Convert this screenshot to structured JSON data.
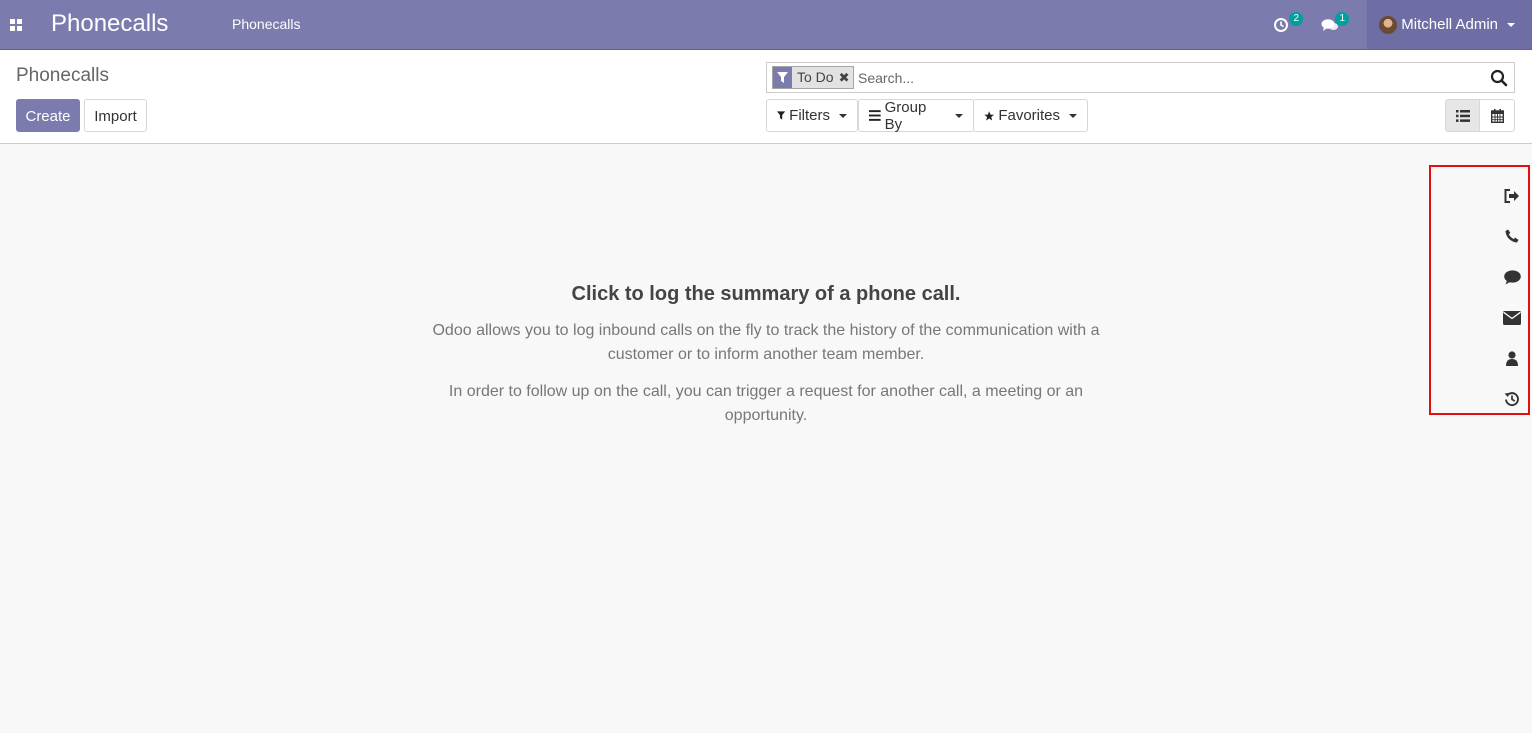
{
  "navbar": {
    "apps_icon": "apps-grid-icon",
    "brand": "Phonecalls",
    "menu_items": [
      "Phonecalls"
    ],
    "activity_icon": "activity-clock-icon",
    "activity_count": "2",
    "messages_icon": "chat-bubbles-icon",
    "messages_count": "1",
    "user_name": "Mitchell Admin"
  },
  "control_panel": {
    "breadcrumb": "Phonecalls",
    "create_label": "Create",
    "import_label": "Import",
    "search": {
      "facet_label": "To Do",
      "facet_icon": "filter-icon",
      "placeholder": "Search...",
      "search_icon": "magnifier-icon"
    },
    "filters_label": "Filters",
    "groupby_label": "Group By",
    "favorites_label": "Favorites",
    "views": [
      "list-view-icon",
      "calendar-view-icon"
    ]
  },
  "helper": {
    "title": "Click to log the summary of a phone call.",
    "p1": "Odoo allows you to log inbound calls on the fly to track the history of the communication with a customer or to inform another team member.",
    "p2": "In order to follow up on the call, you can trigger a request for another call, a meeting or an opportunity."
  },
  "sidebar": {
    "icons": [
      "sign-out-icon",
      "phone-icon",
      "comment-icon",
      "envelope-icon",
      "user-icon",
      "history-icon"
    ]
  },
  "colors": {
    "primary": "#7c7bad",
    "badge": "#00a09d",
    "highlight_border": "#e01010"
  }
}
